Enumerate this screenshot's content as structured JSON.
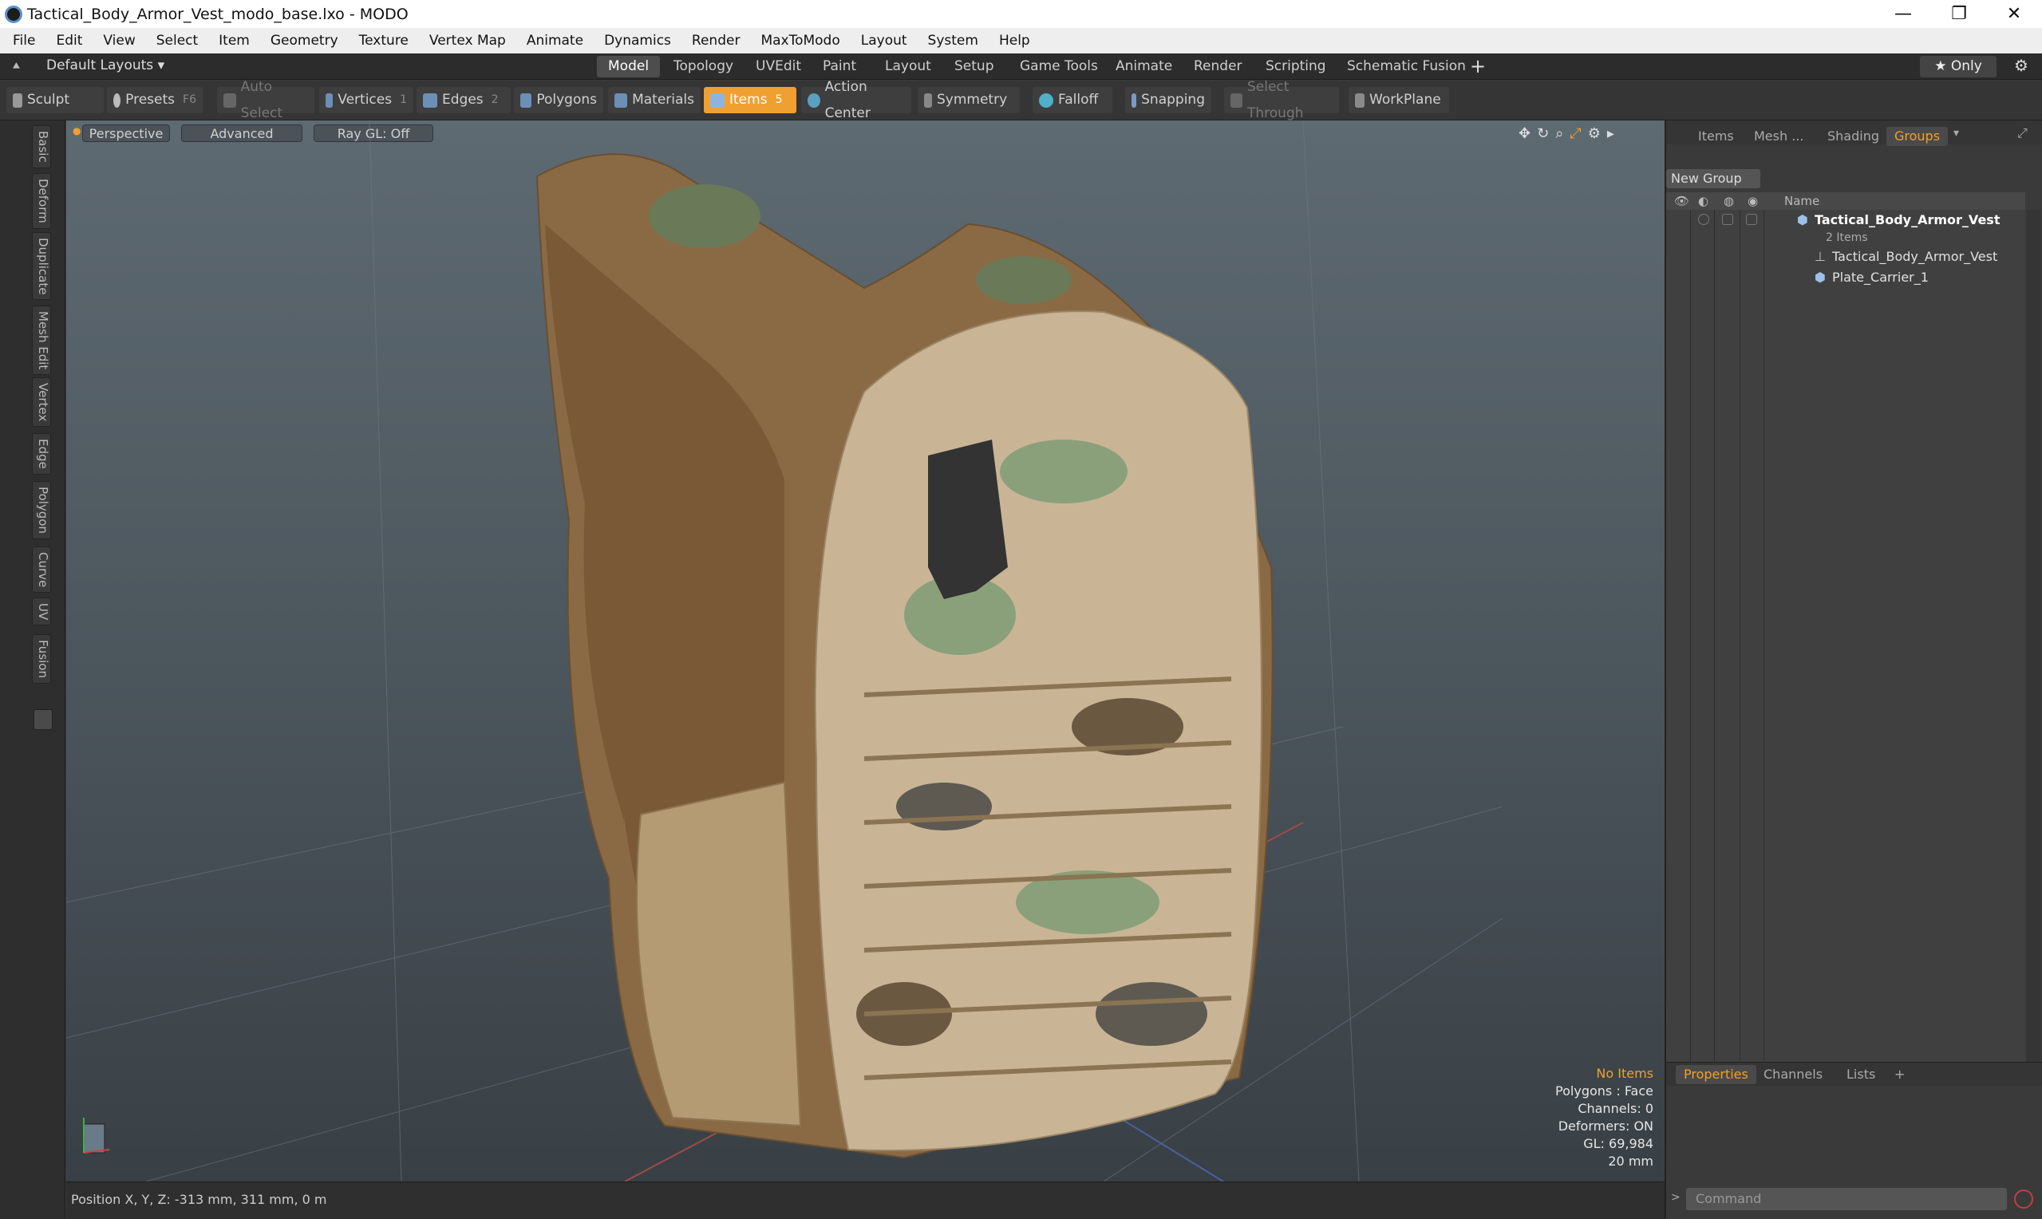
{
  "window": {
    "title": "Tactical_Body_Armor_Vest_modo_base.lxo - MODO",
    "minimize": "—",
    "restore": "❐",
    "close": "✕"
  },
  "menu": [
    "File",
    "Edit",
    "View",
    "Select",
    "Item",
    "Geometry",
    "Texture",
    "Vertex Map",
    "Animate",
    "Dynamics",
    "Render",
    "MaxToModo",
    "Layout",
    "System",
    "Help"
  ],
  "layout_tabs": {
    "layouts_label": "Default Layouts ▾",
    "tabs": [
      "Model",
      "Topology",
      "UVEdit",
      "Paint",
      "Layout",
      "Setup",
      "Game Tools",
      "Animate",
      "Render",
      "Scripting",
      "Schematic Fusion"
    ],
    "active": "Model",
    "add": "+",
    "only_label": "★ Only",
    "settings": "⚙"
  },
  "toolbar": {
    "sculpt": "Sculpt",
    "presets": "Presets",
    "presets_key": "F6",
    "auto_select": "Auto Select",
    "vertices": "Vertices",
    "vertices_count": "1",
    "edges": "Edges",
    "edges_count": "2",
    "polygons": "Polygons",
    "materials": "Materials",
    "items": "Items",
    "items_count": "5",
    "action_center": "Action Center",
    "symmetry": "Symmetry",
    "falloff": "Falloff",
    "snapping": "Snapping",
    "select_through": "Select Through",
    "workplane": "WorkPlane"
  },
  "left_tabs": [
    "Basic",
    "Deform",
    "Duplicate",
    "Mesh Edit",
    "Vertex",
    "Edge",
    "Polygon",
    "Curve",
    "UV",
    "Fusion"
  ],
  "viewport": {
    "perspective": "Perspective",
    "advanced": "Advanced",
    "raygl": "Ray GL: Off",
    "stats": {
      "items": "No Items",
      "polygons": "Polygons : Face",
      "channels": "Channels: 0",
      "deformers": "Deformers: ON",
      "gl": "GL: 69,984",
      "scale": "20 mm"
    }
  },
  "status": {
    "position": "Position X, Y, Z:  -313 mm, 311 mm, 0 m"
  },
  "right_panel": {
    "tabs": [
      "Items",
      "Mesh ...",
      "Shading",
      "Groups"
    ],
    "active_tab": "Groups",
    "new_group": "New Group",
    "name_header": "Name",
    "group_name": "Tactical_Body_Armor_Vest",
    "group_count": "2 Items",
    "children": [
      "Tactical_Body_Armor_Vest",
      "Plate_Carrier_1"
    ],
    "bottom_tabs": [
      "Properties",
      "Channels",
      "Lists"
    ],
    "bottom_active": "Properties",
    "bottom_add": "+",
    "command_placeholder": "Command"
  },
  "colors": {
    "accent": "#f0a030",
    "viewport_top": "#5e6a72",
    "viewport_bottom": "#394045"
  }
}
